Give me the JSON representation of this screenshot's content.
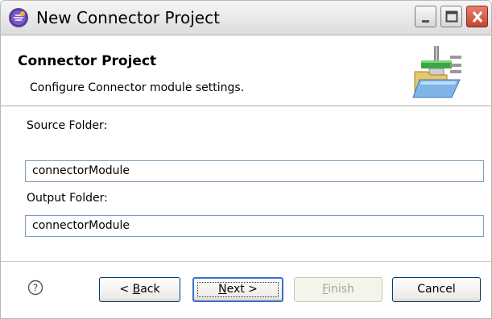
{
  "window": {
    "title": "New Connector Project",
    "icons": {
      "app": "eclipse-icon",
      "minimize": "minimize-icon",
      "maximize": "maximize-icon",
      "close": "close-icon"
    }
  },
  "banner": {
    "title": "Connector Project",
    "description": "Configure Connector module settings.",
    "icon": "connector-folder-icon"
  },
  "form": {
    "source_label": "Source Folder:",
    "source_value": "connectorModule",
    "output_label": "Output Folder:",
    "output_value": "connectorModule"
  },
  "footer": {
    "help_icon": "help-icon",
    "back": {
      "prefix": "< ",
      "mnemonic": "B",
      "suffix": "ack"
    },
    "next": {
      "mnemonic": "N",
      "suffix": "ext >"
    },
    "finish": {
      "mnemonic": "F",
      "suffix": "inish"
    },
    "cancel": "Cancel"
  },
  "colors": {
    "accent": "#3c6ed3",
    "close_button": "#c3452e",
    "input_border": "#7f9db9"
  }
}
